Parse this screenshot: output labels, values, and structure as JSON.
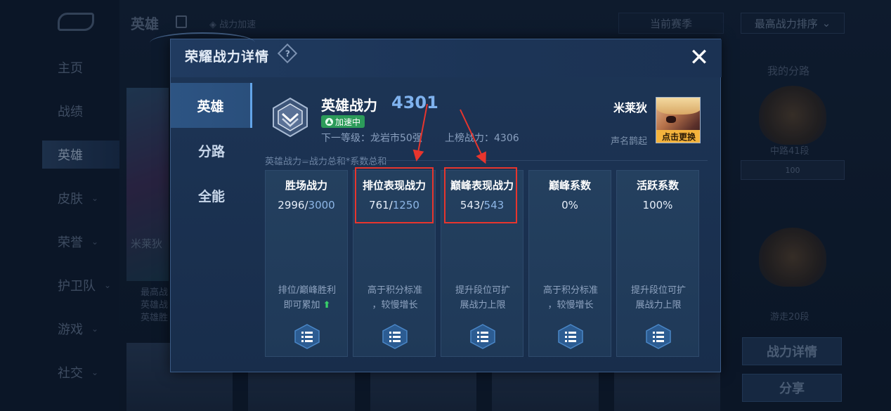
{
  "background": {
    "nav_items": [
      {
        "label": "主页",
        "chevron": false
      },
      {
        "label": "战绩",
        "chevron": false
      },
      {
        "label": "英雄",
        "chevron": false,
        "active": true
      },
      {
        "label": "皮肤",
        "chevron": true
      },
      {
        "label": "荣誉",
        "chevron": true
      },
      {
        "label": "护卫队",
        "chevron": true
      },
      {
        "label": "游戏",
        "chevron": true
      },
      {
        "label": "社交",
        "chevron": true
      }
    ],
    "page_title": "英雄",
    "speed_label": "战力加速",
    "season_select": "当前赛季",
    "sort_select": "最高战力排序",
    "hero_card_name": "米莱狄",
    "hero_card_desc": [
      "最高战",
      "英雄战",
      "英雄胜"
    ],
    "right_panel": {
      "title": "我的分路",
      "rank1": "中路41段",
      "rank_plate": "100",
      "rank2": "游走20段",
      "detail_button": "战力详情",
      "share_button": "分享"
    }
  },
  "modal": {
    "title": "荣耀战力详情",
    "help_icon": "?",
    "close_icon": "✕",
    "tabs": [
      {
        "label": "英雄",
        "active": true
      },
      {
        "label": "分路",
        "active": false
      },
      {
        "label": "全能",
        "active": false
      }
    ],
    "summary": {
      "label": "英雄战力",
      "value": "4301",
      "speed_badge": "加速中",
      "next_level": "下一等级：龙岩市50强",
      "list_power": "上榜战力：4306",
      "hero_name": "米莱狄",
      "hero_fame": "声名鹊起",
      "change_button": "点击更换"
    },
    "formula": "英雄战力=战力总和*系数总和",
    "cards": [
      {
        "title": "胜场战力",
        "value": "2996",
        "max": "3000",
        "desc1": "排位/巅峰胜利",
        "desc2": "即可累加",
        "arrow": "⬆"
      },
      {
        "title": "排位表现战力",
        "value": "761",
        "max": "1250",
        "desc1": "高于积分标准",
        "desc2": "，较慢增长",
        "arrow": ""
      },
      {
        "title": "巅峰表现战力",
        "value": "543",
        "max": "543",
        "desc1": "提升段位可扩",
        "desc2": "展战力上限",
        "arrow": ""
      },
      {
        "title": "巅峰系数",
        "value": "0%",
        "max": "",
        "desc1": "高于积分标准",
        "desc2": "，较慢增长",
        "arrow": ""
      },
      {
        "title": "活跃系数",
        "value": "100%",
        "max": "",
        "desc1": "提升段位可扩",
        "desc2": "展战力上限",
        "arrow": ""
      }
    ]
  },
  "colors": {
    "accent_blue": "#7fb2ee",
    "highlight_red": "#e8352d",
    "badge_green": "#2c9b5a",
    "change_btn": "#f4b33c"
  }
}
